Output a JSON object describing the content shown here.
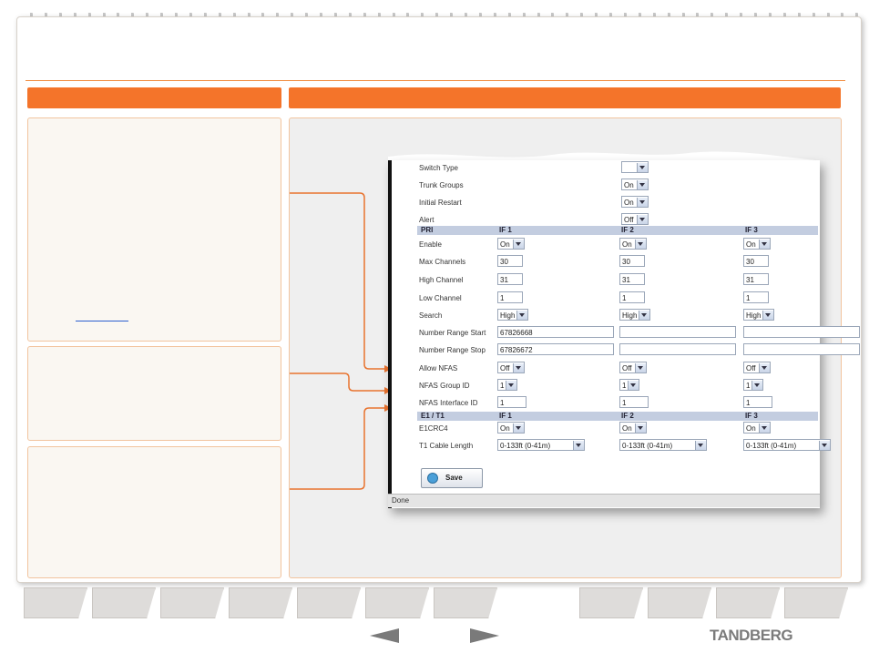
{
  "form": {
    "rows_top": [
      {
        "label": "Switch Type",
        "value": ""
      },
      {
        "label": "Trunk Groups",
        "value": "On"
      },
      {
        "label": "Initial Restart",
        "value": "On"
      },
      {
        "label": "Alert",
        "value": "Off"
      }
    ],
    "pri": {
      "title": "PRI",
      "columns": [
        "IF 1",
        "IF 2",
        "IF 3"
      ],
      "rows": [
        {
          "label": "Enable",
          "values": [
            "On",
            "On",
            "On"
          ]
        },
        {
          "label": "Max Channels",
          "values": [
            "30",
            "30",
            "30"
          ]
        },
        {
          "label": "High Channel",
          "values": [
            "31",
            "31",
            "31"
          ]
        },
        {
          "label": "Low Channel",
          "values": [
            "1",
            "1",
            "1"
          ]
        },
        {
          "label": "Search",
          "values": [
            "High",
            "High",
            "High"
          ]
        },
        {
          "label": "Number Range Start",
          "values": [
            "67826668",
            "",
            ""
          ]
        },
        {
          "label": "Number Range Stop",
          "values": [
            "67826672",
            "",
            ""
          ]
        },
        {
          "label": "Allow NFAS",
          "values": [
            "Off",
            "Off",
            "Off"
          ]
        },
        {
          "label": "NFAS Group ID",
          "values": [
            "1",
            "1",
            "1"
          ]
        },
        {
          "label": "NFAS Interface ID",
          "values": [
            "1",
            "1",
            "1"
          ]
        }
      ]
    },
    "e1t1": {
      "title": "E1 / T1",
      "columns": [
        "IF 1",
        "IF 2",
        "IF 3"
      ],
      "rows": [
        {
          "label": "E1CRC4",
          "values": [
            "On",
            "On",
            "On"
          ]
        },
        {
          "label": "T1 Cable Length",
          "values": [
            "0-133ft (0-41m)",
            "0-133ft (0-41m)",
            "0-133ft (0-41m)"
          ]
        }
      ]
    },
    "save_label": "Save",
    "status_text": "Done"
  },
  "brand": {
    "logo_text": "TANDBERG"
  },
  "colors": {
    "accent": "#f4742a",
    "section_bar": "#c3cde0"
  }
}
